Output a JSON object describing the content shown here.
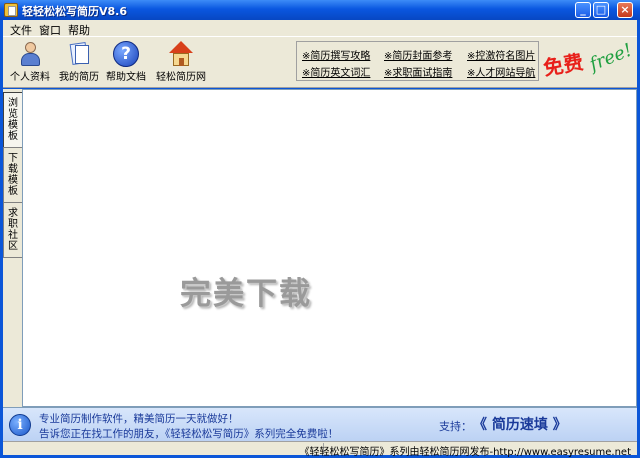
{
  "window": {
    "title": "轻轻松松写简历V8.6"
  },
  "titlebar_buttons": {
    "minimize": "_",
    "maximize": "□",
    "close": "×"
  },
  "menu": [
    "文件",
    "窗口",
    "帮助"
  ],
  "toolbar": {
    "personal": "个人资料",
    "myresume": "我的简历",
    "help": "帮助文档",
    "site": "轻松简历网",
    "help_glyph": "?"
  },
  "links": [
    "※简历撰写攻略",
    "※简历封面参考",
    "※控激符名图片",
    "※简历英文词汇",
    "※求职面试指南",
    "※人才网站导航"
  ],
  "free_badge": {
    "cn": "免费",
    "en": "free!"
  },
  "side_tabs": [
    "浏览模板",
    "下载模板",
    "求职社区"
  ],
  "watermark": "完美下载",
  "promo": {
    "info_glyph": "i",
    "line1": "专业简历制作软件，精美简历一天就做好！",
    "line2": "告诉您正在找工作的朋友，《轻轻松松写简历》系列完全免费啦！",
    "support_label": "支持：",
    "support_name": "《 简历速填 》"
  },
  "status": "《轻轻松松写简历》系列由轻松简历网发布-http://www.easyresume.net",
  "colors": {
    "titlebar": "#0a57e0",
    "chrome": "#ece9d8",
    "promo": "#bcd2f4",
    "free_red": "#e8201a",
    "free_green": "#20a040"
  }
}
